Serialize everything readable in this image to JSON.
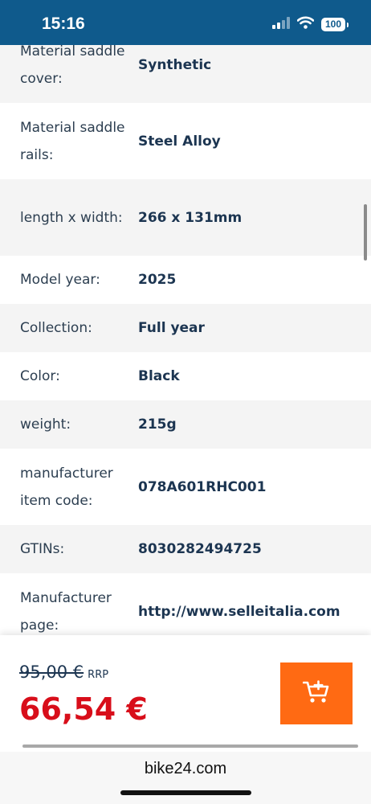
{
  "status_bar": {
    "time": "15:16",
    "battery": "100"
  },
  "specs": [
    {
      "label": "Material saddle cover:",
      "value": "Synthetic"
    },
    {
      "label": "Material saddle rails:",
      "value": "Steel Alloy"
    },
    {
      "label": "length x width:",
      "value": "266 x 131mm"
    },
    {
      "label": "Model year:",
      "value": "2025"
    },
    {
      "label": "Collection:",
      "value": "Full year"
    },
    {
      "label": "Color:",
      "value": "Black"
    },
    {
      "label": "weight:",
      "value": "215g"
    },
    {
      "label": "manufacturer item code:",
      "value": "078A601RHC001"
    },
    {
      "label": "GTINs:",
      "value": "8030282494725"
    },
    {
      "label": "Manufacturer page:",
      "value": "http://www.selleitalia.com"
    }
  ],
  "price": {
    "old_price": "95,00 €",
    "rrp_label": "RRP",
    "current_price": "66,54 €"
  },
  "browser": {
    "url": "bike24.com"
  },
  "colors": {
    "status_bar": "#0f5a8c",
    "price": "#d80e1a",
    "cart_button": "#ff6a13",
    "text": "#1c3551"
  },
  "icons": {
    "cart": "cart-plus-icon",
    "signal": "cellular-signal-icon",
    "wifi": "wifi-icon",
    "battery": "battery-icon"
  }
}
